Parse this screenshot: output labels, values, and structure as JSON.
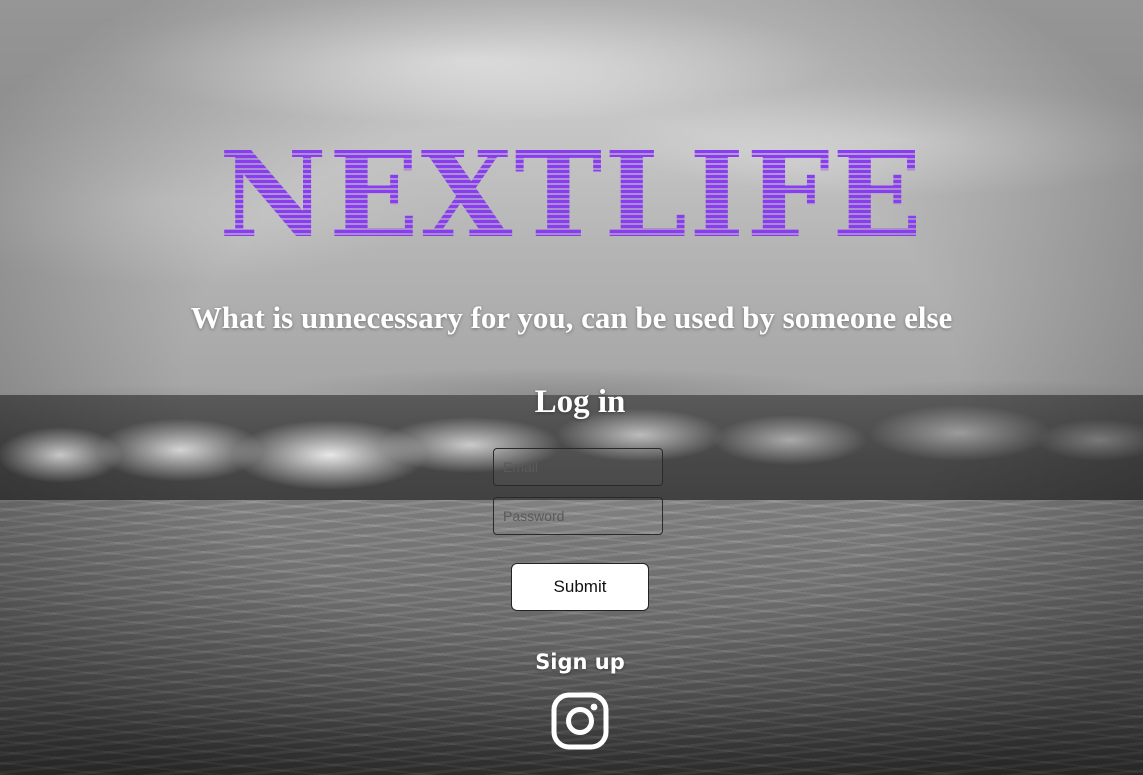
{
  "brand": {
    "name": "NEXTLIFE",
    "color": "#8a3cf0"
  },
  "tagline": "What is unnecessary for you, can be used by someone else",
  "login": {
    "title": "Log in",
    "email_placeholder": "Email",
    "password_placeholder": "Password",
    "submit_label": "Submit"
  },
  "signup_label": "Sign up",
  "social": {
    "icon": "instagram-icon"
  }
}
